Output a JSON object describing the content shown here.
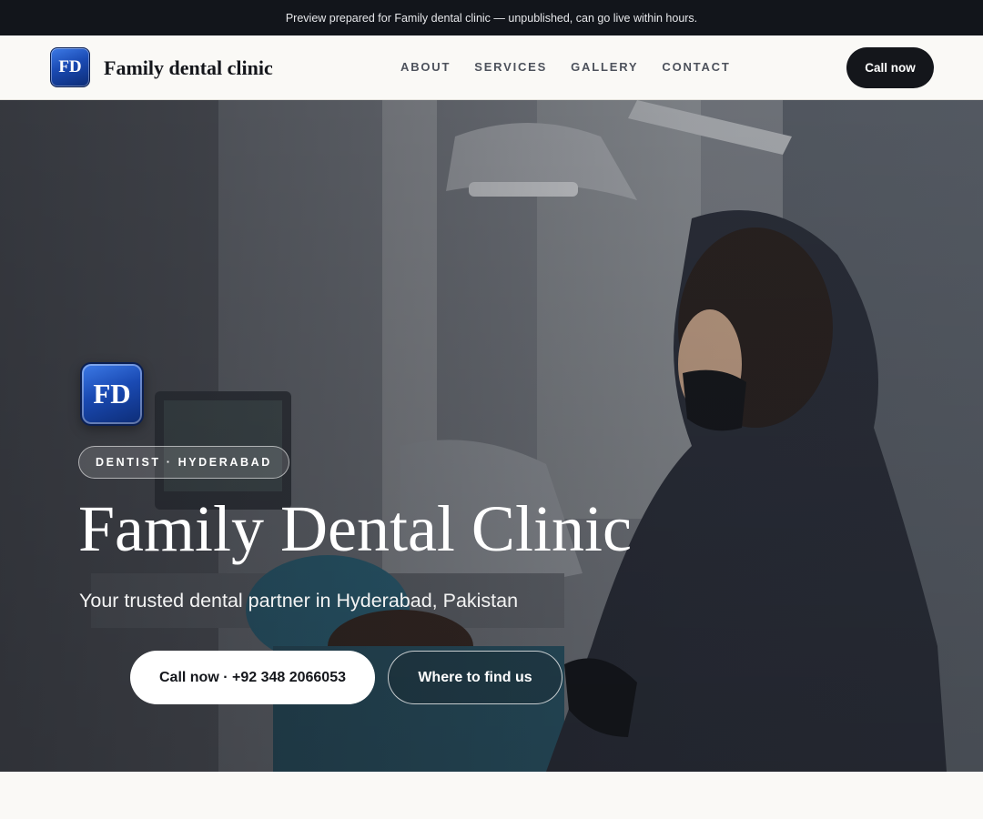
{
  "preview_bar": {
    "text": "Preview prepared for Family dental clinic — unpublished, can go live within hours."
  },
  "header": {
    "logo_text": "FD",
    "brand_name": "Family dental clinic",
    "nav": [
      "ABOUT",
      "SERVICES",
      "GALLERY",
      "CONTACT"
    ],
    "cta_label": "Call now"
  },
  "hero": {
    "logo_text": "FD",
    "tag": "DENTIST · HYDERABAD",
    "title": "Family Dental Clinic",
    "subtitle": "Your trusted dental partner in Hyderabad, Pakistan",
    "call_button": "Call now · +92 348 2066053",
    "find_button": "Where to find us",
    "image": "dentist-treating-patient-photo"
  },
  "colors": {
    "dark": "#14161b",
    "brand_blue": "#1a4ab3",
    "background": "#faf9f6"
  }
}
